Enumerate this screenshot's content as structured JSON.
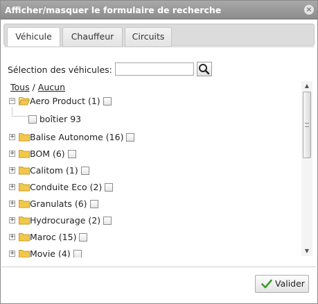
{
  "dialog": {
    "title": "Afficher/masquer le formulaire de recherche",
    "close_icon": "close-icon"
  },
  "tabs": [
    {
      "label": "Véhicule",
      "active": true
    },
    {
      "label": "Chauffeur",
      "active": false
    },
    {
      "label": "Circuits",
      "active": false
    }
  ],
  "search": {
    "label": "Sélection des véhicules:",
    "value": "",
    "placeholder": "",
    "button_icon": "search-icon"
  },
  "selection_links": {
    "all": "Tous",
    "separator": "/",
    "none": "Aucun"
  },
  "tree": {
    "groups": [
      {
        "label": "Aero Product (1)",
        "expanded": true,
        "children": [
          {
            "label": "boîtier 93"
          }
        ]
      },
      {
        "label": "Balise Autonome (16)",
        "expanded": false
      },
      {
        "label": "BOM (6)",
        "expanded": false
      },
      {
        "label": "Calitom (1)",
        "expanded": false
      },
      {
        "label": "Conduite Eco (2)",
        "expanded": false
      },
      {
        "label": "Granulats (6)",
        "expanded": false
      },
      {
        "label": "Hydrocurage (2)",
        "expanded": false
      },
      {
        "label": "Maroc (15)",
        "expanded": false
      },
      {
        "label": "Movie (4)",
        "expanded": false
      }
    ]
  },
  "footer": {
    "validate_label": "Valider",
    "validate_icon": "checkmark-icon"
  },
  "colors": {
    "titlebar": "#9a9a9a",
    "folder": "#f2c84b",
    "checkmark": "#3c9a2c"
  }
}
